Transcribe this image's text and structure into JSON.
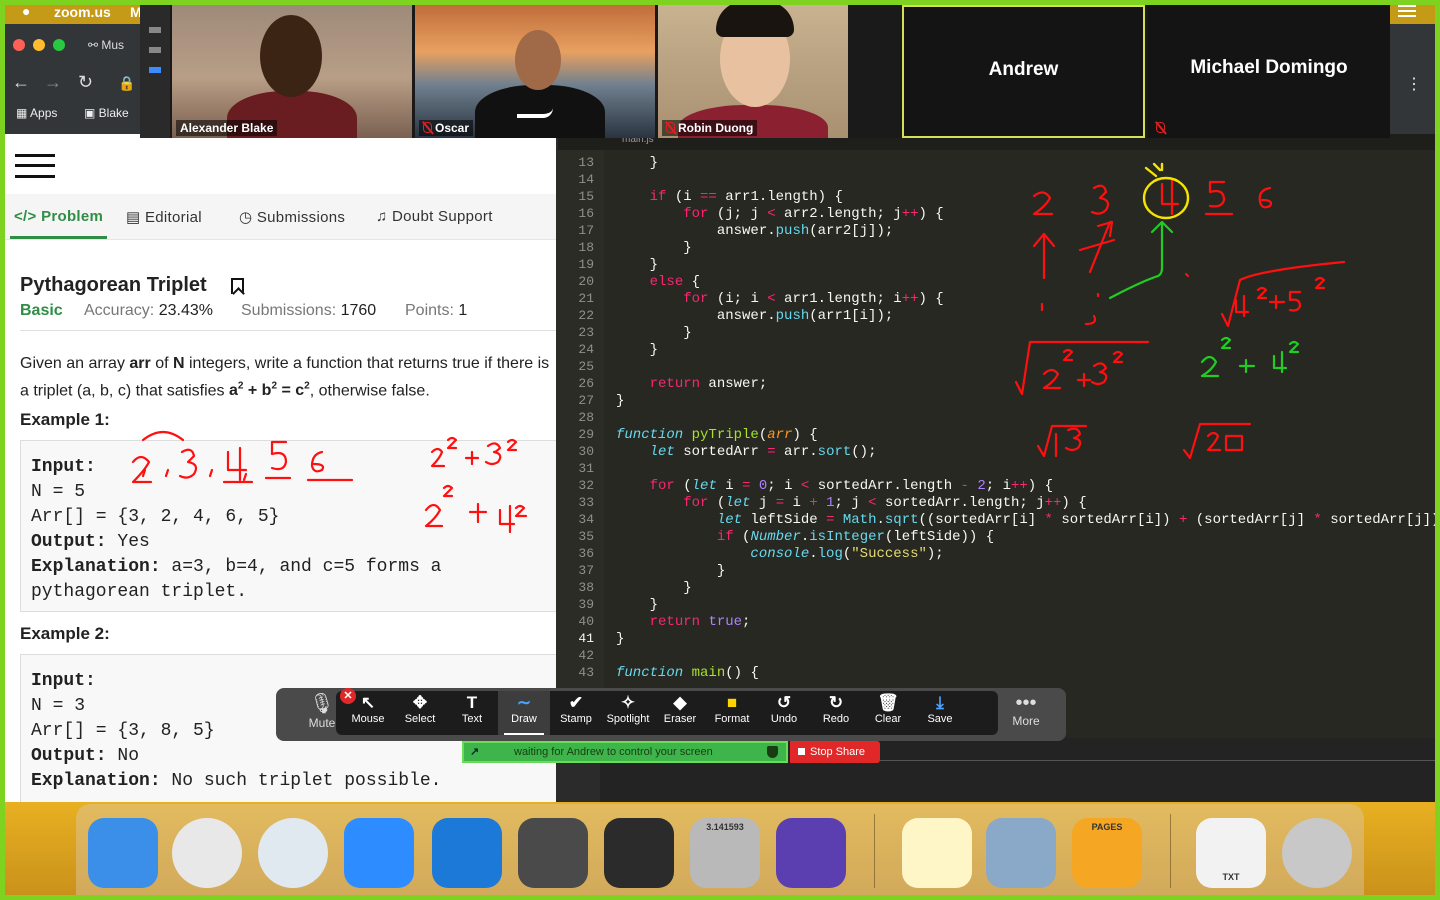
{
  "menubar": {
    "apple": "",
    "app_name": "zoom.us",
    "menu_fragment": "M"
  },
  "browser": {
    "tab_fragment": "Mus",
    "bookmarks": [
      {
        "label": "Apps"
      },
      {
        "label": "Blake"
      }
    ]
  },
  "participants": [
    {
      "name": "Alexander Blake",
      "muted": false,
      "video": true
    },
    {
      "name": "Oscar",
      "muted": true,
      "video": true
    },
    {
      "name": "Robin Duong",
      "muted": true,
      "video": true
    },
    {
      "name": "Andrew",
      "muted": false,
      "video": false
    },
    {
      "name": "Michael Domingo",
      "muted": true,
      "video": false
    }
  ],
  "problem": {
    "tabs": [
      {
        "label": "Problem",
        "icon": "code-icon",
        "active": true
      },
      {
        "label": "Editorial",
        "icon": "document-icon"
      },
      {
        "label": "Submissions",
        "icon": "clock-icon"
      },
      {
        "label": "Doubt Support",
        "icon": "headset-icon"
      }
    ],
    "title": "Pythagorean Triplet",
    "difficulty": "Basic",
    "accuracy_label": "Accuracy:",
    "accuracy": "23.43%",
    "submissions_label": "Submissions:",
    "submissions": "1760",
    "points_label": "Points:",
    "points": "1",
    "desc_1": "Given an array ",
    "desc_arr": "arr",
    "desc_2": " of ",
    "desc_n": "N",
    "desc_3": " integers, write a function that returns true if there is a triplet (a, b, c) that satisfies ",
    "desc_eq_a": "a",
    "desc_eq_sq1": "2",
    "desc_eq_plus": " + ",
    "desc_eq_b": "b",
    "desc_eq_sq2": "2",
    "desc_eq_eq": " = ",
    "desc_eq_c": "c",
    "desc_eq_sq3": "2",
    "desc_4": ", otherwise false.",
    "example1": {
      "heading": "Example 1:",
      "input_label": "Input:",
      "n_line": "N = 5",
      "arr_line": "Arr[] = {3, 2, 4, 6, 5}",
      "output_label": "Output:",
      "output": " Yes",
      "explanation_label": "Explanation:",
      "explanation_1": " a=3, b=4, and c=5 forms a",
      "explanation_2": "pythagorean triplet."
    },
    "example2": {
      "heading": "Example 2:",
      "input_label": "Input:",
      "n_line": "N = 3",
      "arr_line": "Arr[] = {3, 8, 5}",
      "output_label": "Output:",
      "output": " No",
      "explanation_label": "Explanation:",
      "explanation_1": " No such triplet possible."
    }
  },
  "editor": {
    "tab_fragment": "main.js",
    "current_line": 41,
    "lines": [
      {
        "n": 13,
        "html": "    }"
      },
      {
        "n": 14,
        "html": ""
      },
      {
        "n": 15,
        "html": "    <span class=\"kw\">if</span> (i <span class=\"kw\">==</span> arr1.length) {"
      },
      {
        "n": 16,
        "html": "        <span class=\"kw\">for</span> (j; j <span class=\"kw\">&lt;</span> arr2.length; j<span class=\"kw\">++</span>) {"
      },
      {
        "n": 17,
        "html": "            answer.<span class=\"bi\">push</span>(arr2[j]);"
      },
      {
        "n": 18,
        "html": "        }"
      },
      {
        "n": 19,
        "html": "    }"
      },
      {
        "n": 20,
        "html": "    <span class=\"kw\">else</span> {"
      },
      {
        "n": 21,
        "html": "        <span class=\"kw\">for</span> (i; i <span class=\"kw\">&lt;</span> arr1.length; i<span class=\"kw\">++</span>) {"
      },
      {
        "n": 22,
        "html": "            answer.<span class=\"bi\">push</span>(arr1[i]);"
      },
      {
        "n": 23,
        "html": "        }"
      },
      {
        "n": 24,
        "html": "    }"
      },
      {
        "n": 25,
        "html": ""
      },
      {
        "n": 26,
        "html": "    <span class=\"kw\">return</span> answer;"
      },
      {
        "n": 27,
        "html": "}"
      },
      {
        "n": 28,
        "html": ""
      },
      {
        "n": 29,
        "html": "<span class=\"it\">function</span> <span class=\"fn\">pyTriple</span>(<span class=\"par\">arr</span>) {"
      },
      {
        "n": 30,
        "html": "    <span class=\"it\">let</span> sortedArr <span class=\"kw\">=</span> arr.<span class=\"bi\">sort</span>();"
      },
      {
        "n": 31,
        "html": ""
      },
      {
        "n": 32,
        "html": "    <span class=\"kw\">for</span> (<span class=\"it\">let</span> i <span class=\"kw\">=</span> <span class=\"num\">0</span>; i <span class=\"kw\">&lt;</span> sortedArr.length <span class=\"kw\">-</span> <span class=\"num\">2</span>; i<span class=\"kw\">++</span>) {"
      },
      {
        "n": 33,
        "html": "        <span class=\"kw\">for</span> (<span class=\"it\">let</span> j <span class=\"kw\">=</span> i <span class=\"kw\">+</span> <span class=\"num\">1</span>; j <span class=\"kw\">&lt;</span> sortedArr.length; j<span class=\"kw\">++</span>) {"
      },
      {
        "n": 34,
        "html": "            <span class=\"it\">let</span> leftSide <span class=\"kw\">=</span> <span class=\"bi\">Math</span>.<span class=\"bi\">sqrt</span>((sortedArr[i] <span class=\"kw\">*</span> sortedArr[i]) <span class=\"kw\">+</span> (sortedArr[j] <span class=\"kw\">*</span> sortedArr[j]));"
      },
      {
        "n": 35,
        "html": "            <span class=\"kw\">if</span> (<span class=\"it\">Number</span>.<span class=\"bi\">isInteger</span>(leftSide)) {"
      },
      {
        "n": 36,
        "html": "                <span class=\"it\">console</span>.<span class=\"bi\">log</span>(<span class=\"str\">\"Success\"</span>);"
      },
      {
        "n": 37,
        "html": "            }"
      },
      {
        "n": 38,
        "html": "        }"
      },
      {
        "n": 39,
        "html": "    }"
      },
      {
        "n": 40,
        "html": "    <span class=\"kw\">return</span> <span class=\"num\">true</span>;"
      },
      {
        "n": 41,
        "html": "}"
      },
      {
        "n": 42,
        "html": ""
      },
      {
        "n": 43,
        "html": "<span class=\"it\">function</span> <span class=\"fn\">main</span>() {"
      }
    ]
  },
  "annotation_toolbar": {
    "mute": "Mute",
    "tools": [
      {
        "label": "Mouse",
        "icon": "arrow-cursor-icon",
        "glyph": "↖"
      },
      {
        "label": "Select",
        "icon": "move-icon",
        "glyph": "✥"
      },
      {
        "label": "Text",
        "icon": "text-icon",
        "glyph": "T"
      },
      {
        "label": "Draw",
        "icon": "draw-icon",
        "glyph": "∼",
        "selected": true
      },
      {
        "label": "Stamp",
        "icon": "checkmark-icon",
        "glyph": "✔"
      },
      {
        "label": "Spotlight",
        "icon": "spotlight-icon",
        "glyph": "✧"
      },
      {
        "label": "Eraser",
        "icon": "eraser-icon",
        "glyph": "◆"
      },
      {
        "label": "Format",
        "icon": "format-icon",
        "glyph": "■"
      },
      {
        "label": "Undo",
        "icon": "undo-icon",
        "glyph": "↺"
      },
      {
        "label": "Redo",
        "icon": "redo-icon",
        "glyph": "↻"
      },
      {
        "label": "Clear",
        "icon": "trash-icon",
        "glyph": "🗑"
      },
      {
        "label": "Save",
        "icon": "save-icon",
        "glyph": "⤓"
      }
    ],
    "more": "More"
  },
  "share_status": {
    "text": "waiting for Andrew to control your screen",
    "stop_label": "Stop Share"
  },
  "dock": [
    {
      "name": "finder-icon",
      "color": "#3b8fe8"
    },
    {
      "name": "chrome-icon",
      "color": "#e8e8e8"
    },
    {
      "name": "safari-icon",
      "color": "#e0e8f0"
    },
    {
      "name": "zoom-icon",
      "color": "#2d8cff"
    },
    {
      "name": "xcode-icon",
      "color": "#1c79d8"
    },
    {
      "name": "sublime-text-icon",
      "color": "#4a4a4a"
    },
    {
      "name": "terminal-icon",
      "color": "#2b2b2b"
    },
    {
      "name": "calculator-icon",
      "color": "#b9b9b9",
      "caption": "3.141593"
    },
    {
      "name": "imovie-icon",
      "color": "#5b3fb0"
    },
    {
      "name": "notes-icon",
      "color": "#fff6c8"
    },
    {
      "name": "preview-icon",
      "color": "#8aa8c8"
    },
    {
      "name": "pages-icon",
      "color": "#f5a623",
      "caption": "PAGES"
    },
    {
      "name": "txt-file-icon",
      "color": "#f2f2f2",
      "caption": "TXT"
    },
    {
      "name": "trash-icon",
      "color": "#c8c8c8"
    }
  ],
  "ink_colors": {
    "red": "#ff1010",
    "green": "#22cc22",
    "yellow": "#f5e400"
  }
}
